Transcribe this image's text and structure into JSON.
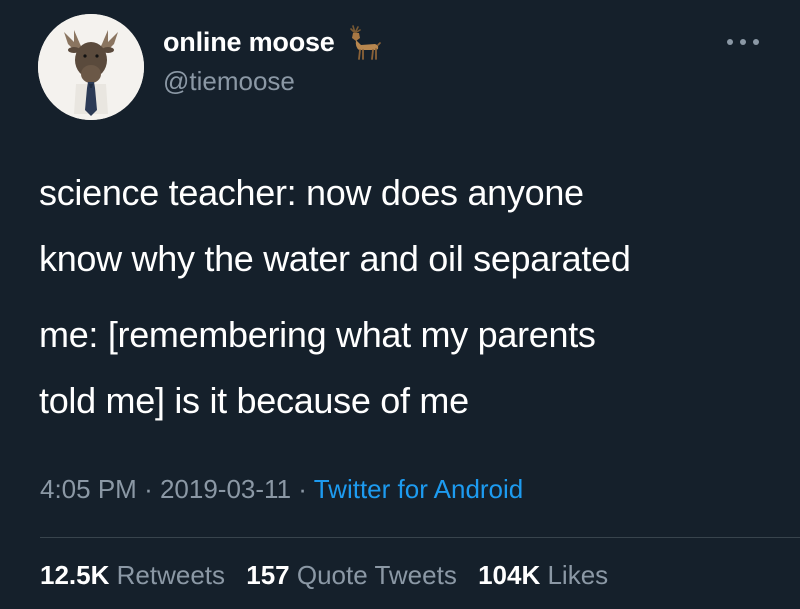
{
  "author": {
    "display_name": "online moose",
    "handle": "@tiemoose",
    "name_emoji": "deer-icon",
    "avatar": "moose-with-tie-avatar"
  },
  "tweet": {
    "paragraph1": {
      "line1": "science teacher: now does anyone",
      "line2": "know why the water and oil separated"
    },
    "paragraph2": {
      "line1": "me: [remembering what my parents",
      "line2": "told me] is it because of me"
    }
  },
  "meta": {
    "time": "4:05 PM",
    "separator": "·",
    "date": "2019-03-11",
    "source": "Twitter for Android"
  },
  "stats": {
    "retweets_count": "12.5K",
    "retweets_label": "Retweets",
    "quote_count": "157",
    "quote_label": "Quote Tweets",
    "likes_count": "104K",
    "likes_label": "Likes"
  },
  "colors": {
    "background": "#15202b",
    "text": "#ffffff",
    "secondary": "#8b98a5",
    "link": "#1d9bf0",
    "divider": "#38444d"
  }
}
